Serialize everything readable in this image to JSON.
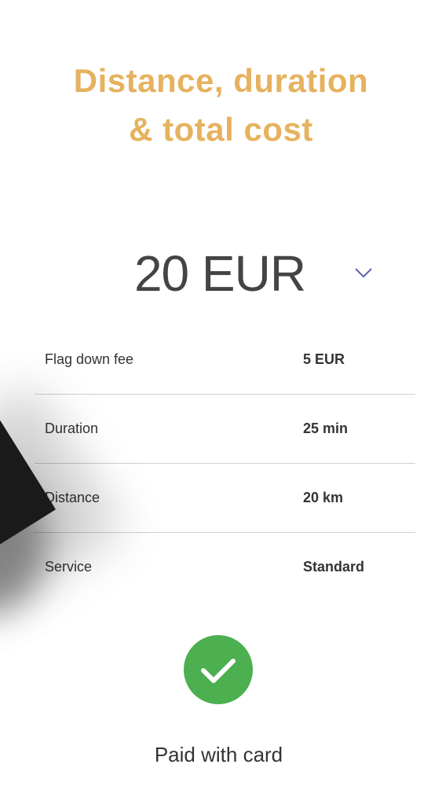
{
  "headline": {
    "line1": "Distance, duration",
    "line2": "& total cost"
  },
  "total": {
    "amount": "20 EUR",
    "expand_icon": "chevron-down-icon"
  },
  "details": [
    {
      "label": "Flag down fee",
      "value": "5 EUR"
    },
    {
      "label": "Duration",
      "value": "25 min"
    },
    {
      "label": "Distance",
      "value": "20 km"
    },
    {
      "label": "Service",
      "value": "Standard"
    }
  ],
  "payment": {
    "icon": "checkmark-icon",
    "label": "Paid with card"
  },
  "colors": {
    "headline": "#e6b25f",
    "success": "#4caf50",
    "chevron": "#5b5fb5",
    "divider": "#cfcfcf"
  }
}
